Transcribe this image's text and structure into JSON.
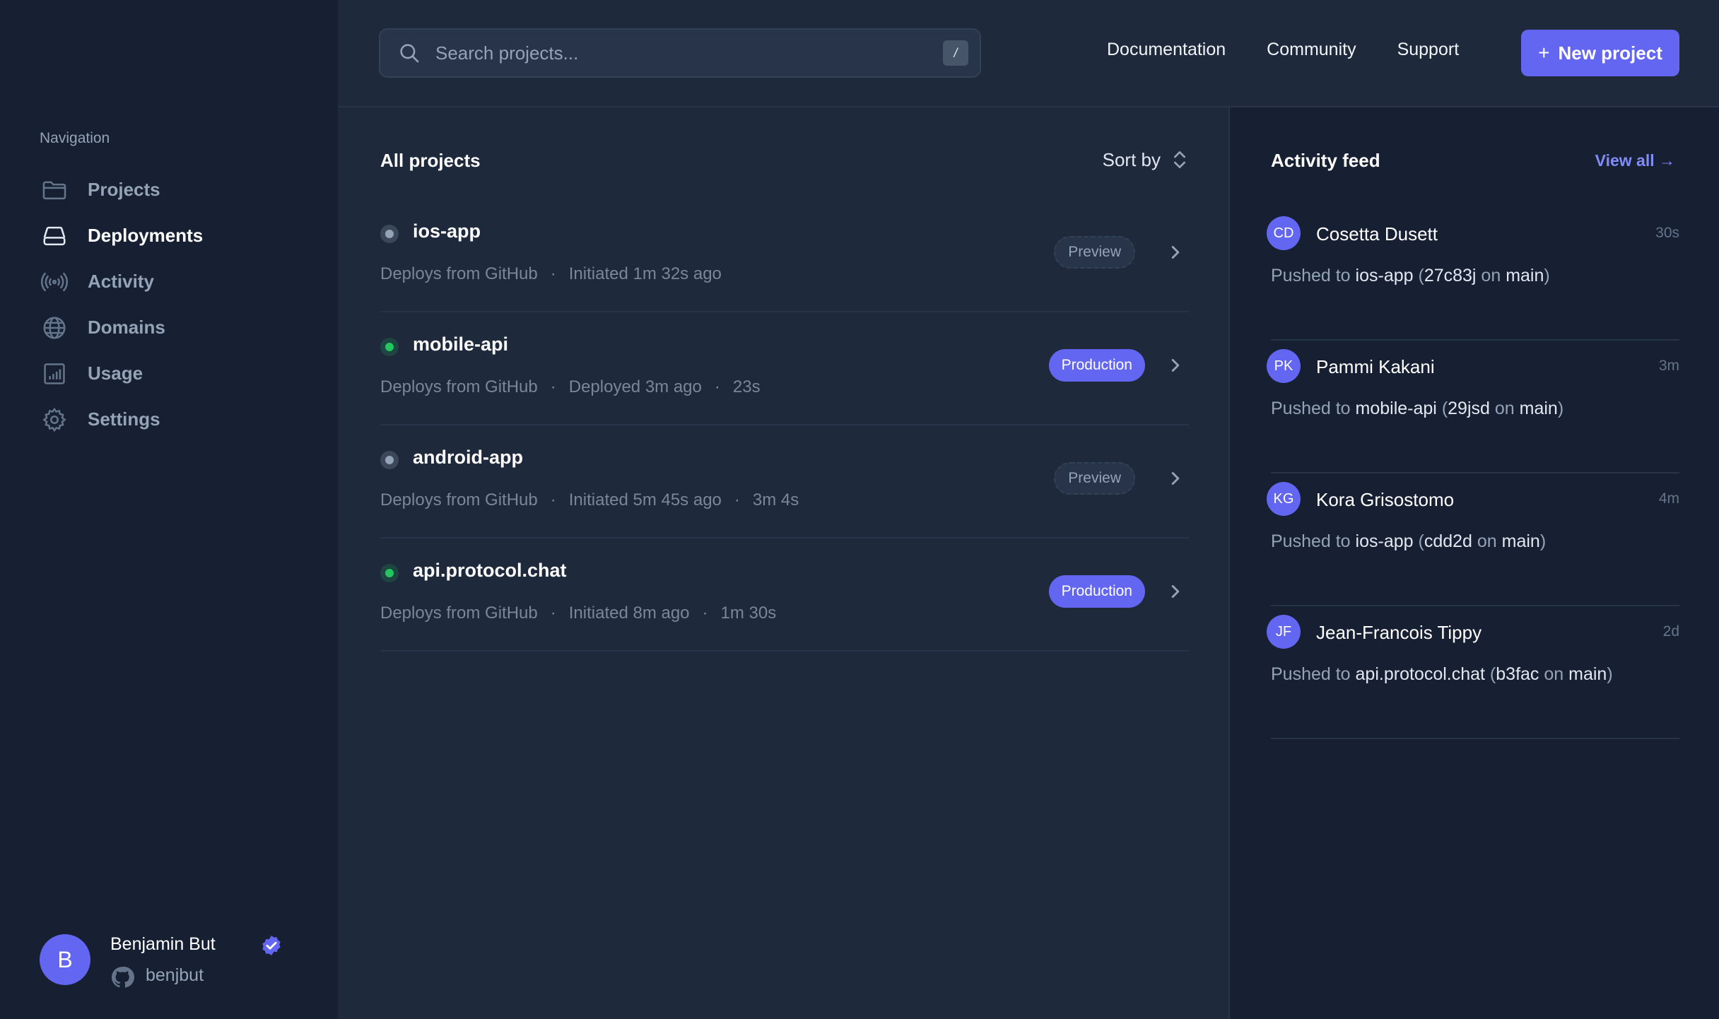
{
  "sidebar": {
    "heading": "Navigation",
    "items": [
      {
        "label": "Projects",
        "icon": "folder-icon"
      },
      {
        "label": "Deployments",
        "icon": "server-icon"
      },
      {
        "label": "Activity",
        "icon": "signal-icon"
      },
      {
        "label": "Domains",
        "icon": "globe-icon"
      },
      {
        "label": "Usage",
        "icon": "chart-icon"
      },
      {
        "label": "Settings",
        "icon": "gear-icon"
      }
    ],
    "active": "Deployments",
    "user": {
      "initial": "B",
      "name": "Benjamin But",
      "handle": "benjbut"
    }
  },
  "topbar": {
    "search_placeholder": "Search projects...",
    "shortcut_key": "/",
    "links": [
      "Documentation",
      "Community",
      "Support"
    ],
    "new_project_label": "New project"
  },
  "projects": {
    "title": "All projects",
    "sort_label": "Sort by",
    "rows": [
      {
        "name": "ios-app",
        "status": "idle",
        "source": "Deploys from GitHub",
        "when": "Initiated 1m 32s ago",
        "duration": "",
        "env": "Preview"
      },
      {
        "name": "mobile-api",
        "status": "live",
        "source": "Deploys from GitHub",
        "when": "Deployed 3m ago",
        "duration": "23s",
        "env": "Production"
      },
      {
        "name": "android-app",
        "status": "idle",
        "source": "Deploys from GitHub",
        "when": "Initiated 5m 45s ago",
        "duration": "3m 4s",
        "env": "Preview"
      },
      {
        "name": "api.protocol.chat",
        "status": "live",
        "source": "Deploys from GitHub",
        "when": "Initiated 8m ago",
        "duration": "1m 30s",
        "env": "Production"
      }
    ]
  },
  "activity": {
    "title": "Activity feed",
    "view_all": "View all →",
    "items": [
      {
        "initials": "CD",
        "name": "Cosetta Dusett",
        "time": "30s",
        "prefix": "Pushed to ",
        "project": "ios-app",
        "commit": "27c83j",
        "branch": "main"
      },
      {
        "initials": "PK",
        "name": "Pammi Kakani",
        "time": "3m",
        "prefix": "Pushed to ",
        "project": "mobile-api",
        "commit": "29jsd",
        "branch": "main"
      },
      {
        "initials": "KG",
        "name": "Kora Grisostomo",
        "time": "4m",
        "prefix": "Pushed to ",
        "project": "ios-app",
        "commit": "cdd2d",
        "branch": "main"
      },
      {
        "initials": "JF",
        "name": "Jean-Francois Tippy",
        "time": "2d",
        "prefix": "Pushed to ",
        "project": "api.protocol.chat",
        "commit": "b3fac",
        "branch": "main"
      }
    ]
  },
  "colors": {
    "accent": "#6366f1",
    "live": "#22c55e",
    "idle": "#94a3b8",
    "bg": "#1e293b",
    "panel": "#172033"
  }
}
